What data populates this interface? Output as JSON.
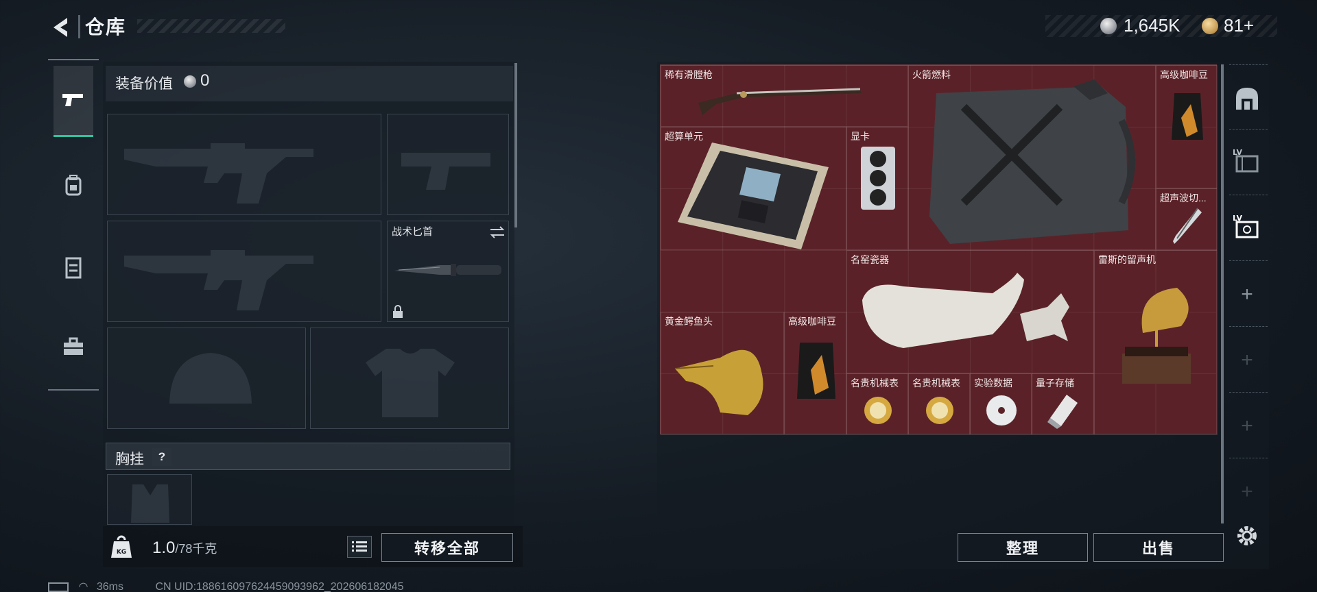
{
  "header": {
    "title": "仓库",
    "currency_silver": "1,645K",
    "currency_gold": "81+"
  },
  "left_tabs": [
    {
      "icon": "pistol-icon",
      "active": true
    },
    {
      "icon": "backpack-icon",
      "active": false
    },
    {
      "icon": "vest-icon",
      "active": false
    },
    {
      "icon": "toolbox-icon",
      "active": false
    }
  ],
  "equipment": {
    "value_label": "装备价值",
    "value": "0",
    "melee_label": "战术匕首",
    "vest_label": "胸挂",
    "vest_help": "?"
  },
  "weight": {
    "current": "1.0",
    "max": "/78千克",
    "transfer_all": "转移全部"
  },
  "status": {
    "ping": "36ms",
    "uid": "CN UID:18861609762445909396​2_202606182045"
  },
  "stash": {
    "items": [
      {
        "label": "稀有滑膛枪"
      },
      {
        "label": "火箭燃料"
      },
      {
        "label": "高级咖啡豆"
      },
      {
        "label": "超算单元"
      },
      {
        "label": "显卡"
      },
      {
        "label": "超声波切..."
      },
      {
        "label": "名窑瓷器"
      },
      {
        "label": "雷斯的留声机"
      },
      {
        "label": "黄金鳄鱼头"
      },
      {
        "label": "高级咖啡豆"
      },
      {
        "label": "名贵机械表"
      },
      {
        "label": "名贵机械表"
      },
      {
        "label": "实验数据"
      },
      {
        "label": "量子存储"
      }
    ],
    "sort_label": "整理",
    "sell_label": "出售"
  },
  "colors": {
    "accent": "#2ec3a0",
    "stash_bg": "#5a2228"
  }
}
